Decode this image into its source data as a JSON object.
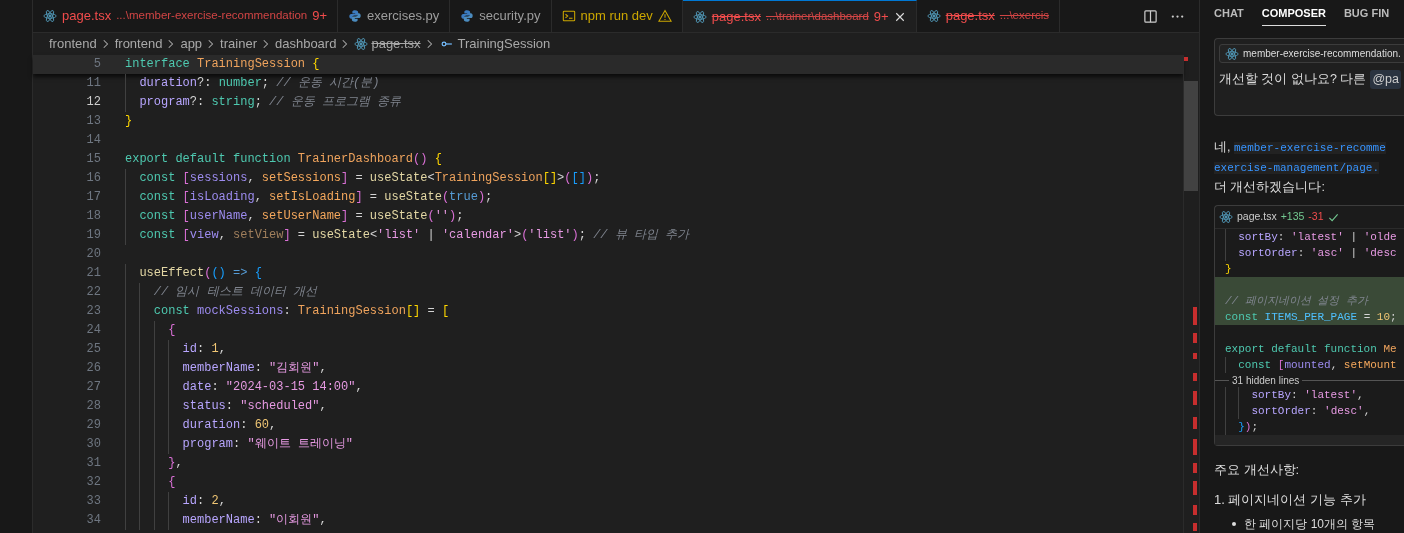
{
  "editor_tabs": [
    {
      "kind": "react",
      "label": "page.tsx",
      "path": "...\\member-exercise-recommendation",
      "badge": "9+",
      "error": true,
      "warning": false,
      "struck": false,
      "selected": false
    },
    {
      "kind": "python",
      "label": "exercises.py",
      "error": false,
      "warning": false,
      "struck": false,
      "selected": false
    },
    {
      "kind": "python",
      "label": "security.py",
      "error": false,
      "warning": false,
      "struck": false,
      "selected": false
    },
    {
      "kind": "terminal",
      "label": "npm run dev",
      "error": false,
      "warning": true,
      "struck": false,
      "selected": false
    },
    {
      "kind": "react",
      "label": "page.tsx",
      "path": "...\\trainer\\dashboard",
      "badge": "9+",
      "error": true,
      "warning": false,
      "struck": true,
      "selected": true
    },
    {
      "kind": "react",
      "label": "page.tsx",
      "path": "...\\exercis",
      "error": true,
      "warning": false,
      "struck": true,
      "selected": false
    }
  ],
  "breadcrumb": [
    {
      "kind": "folder",
      "text": "frontend",
      "struck": false
    },
    {
      "kind": "folder",
      "text": "frontend",
      "struck": false
    },
    {
      "kind": "folder",
      "text": "app",
      "struck": false
    },
    {
      "kind": "folder",
      "text": "trainer",
      "struck": false
    },
    {
      "kind": "folder",
      "text": "dashboard",
      "struck": false
    },
    {
      "kind": "file",
      "text": "page.tsx",
      "struck": true
    },
    {
      "kind": "symbol",
      "text": "TrainingSession",
      "struck": false
    }
  ],
  "code": {
    "lines": [
      {
        "number": "5",
        "sticky": true,
        "active": false,
        "tokens": [
          {
            "text": "interface ",
            "kind": "kw"
          },
          {
            "text": "TrainingSession ",
            "kind": "type"
          },
          {
            "text": "{",
            "kind": "b1"
          }
        ]
      },
      {
        "number": "11",
        "sticky": false,
        "active": false,
        "tokens": [
          {
            "text": "  duration",
            "kind": "prop"
          },
          {
            "text": "?: ",
            "kind": "p"
          },
          {
            "text": "number",
            "kind": "kw"
          },
          {
            "text": "; ",
            "kind": "p"
          },
          {
            "text": "// 운동 시간(분)",
            "kind": "comment"
          }
        ]
      },
      {
        "number": "12",
        "sticky": false,
        "active": true,
        "tokens": [
          {
            "text": "  program",
            "kind": "prop"
          },
          {
            "text": "?: ",
            "kind": "p"
          },
          {
            "text": "string",
            "kind": "kw"
          },
          {
            "text": "; ",
            "kind": "p"
          },
          {
            "text": "// 운동 프로그램 종류",
            "kind": "comment"
          }
        ]
      },
      {
        "number": "13",
        "sticky": false,
        "active": false,
        "tokens": [
          {
            "text": "}",
            "kind": "b1"
          }
        ]
      },
      {
        "number": "14",
        "sticky": false,
        "active": false
      },
      {
        "number": "15",
        "sticky": false,
        "active": false,
        "tokens": [
          {
            "text": "export default function ",
            "kind": "kw"
          },
          {
            "text": "TrainerDashboard",
            "kind": "type"
          },
          {
            "text": "() ",
            "kind": "b2"
          },
          {
            "text": "{",
            "kind": "b1"
          }
        ]
      },
      {
        "number": "16",
        "sticky": false,
        "active": false,
        "tokens": [
          {
            "text": "  const ",
            "kind": "kw"
          },
          {
            "text": "[",
            "kind": "b2"
          },
          {
            "text": "sessions",
            "kind": "var"
          },
          {
            "text": ", ",
            "kind": "p"
          },
          {
            "text": "setSessions",
            "kind": "fn"
          },
          {
            "text": "]",
            "kind": "b2"
          },
          {
            "text": " = ",
            "kind": "p"
          },
          {
            "text": "useState",
            "kind": "call"
          },
          {
            "text": "<",
            "kind": "p"
          },
          {
            "text": "TrainingSession",
            "kind": "type"
          },
          {
            "text": "[]",
            "kind": "b1"
          },
          {
            "text": ">",
            "kind": "p"
          },
          {
            "text": "(",
            "kind": "b2"
          },
          {
            "text": "[]",
            "kind": "b3"
          },
          {
            "text": ")",
            "kind": "b2"
          },
          {
            "text": ";",
            "kind": "p"
          }
        ]
      },
      {
        "number": "17",
        "sticky": false,
        "active": false,
        "tokens": [
          {
            "text": "  const ",
            "kind": "kw"
          },
          {
            "text": "[",
            "kind": "b2"
          },
          {
            "text": "isLoading",
            "kind": "var"
          },
          {
            "text": ", ",
            "kind": "p"
          },
          {
            "text": "setIsLoading",
            "kind": "fn"
          },
          {
            "text": "]",
            "kind": "b2"
          },
          {
            "text": " = ",
            "kind": "p"
          },
          {
            "text": "useState",
            "kind": "call"
          },
          {
            "text": "(",
            "kind": "b2"
          },
          {
            "text": "true",
            "kind": "lit"
          },
          {
            "text": ")",
            "kind": "b2"
          },
          {
            "text": ";",
            "kind": "p"
          }
        ]
      },
      {
        "number": "18",
        "sticky": false,
        "active": false,
        "tokens": [
          {
            "text": "  const ",
            "kind": "kw"
          },
          {
            "text": "[",
            "kind": "b2"
          },
          {
            "text": "userName",
            "kind": "var"
          },
          {
            "text": ", ",
            "kind": "p"
          },
          {
            "text": "setUserName",
            "kind": "fn"
          },
          {
            "text": "]",
            "kind": "b2"
          },
          {
            "text": " = ",
            "kind": "p"
          },
          {
            "text": "useState",
            "kind": "call"
          },
          {
            "text": "(",
            "kind": "b2"
          },
          {
            "text": "''",
            "kind": "str"
          },
          {
            "text": ")",
            "kind": "b2"
          },
          {
            "text": ";",
            "kind": "p"
          }
        ]
      },
      {
        "number": "19",
        "sticky": false,
        "active": false,
        "tokens": [
          {
            "text": "  const ",
            "kind": "kw"
          },
          {
            "text": "[",
            "kind": "b2"
          },
          {
            "text": "view",
            "kind": "var"
          },
          {
            "text": ", ",
            "kind": "p"
          },
          {
            "text": "setView",
            "kind": "unused"
          },
          {
            "text": "]",
            "kind": "b2"
          },
          {
            "text": " = ",
            "kind": "p"
          },
          {
            "text": "useState",
            "kind": "call"
          },
          {
            "text": "<",
            "kind": "p"
          },
          {
            "text": "'list'",
            "kind": "str"
          },
          {
            "text": " | ",
            "kind": "p"
          },
          {
            "text": "'calendar'",
            "kind": "str"
          },
          {
            "text": ">",
            "kind": "p"
          },
          {
            "text": "(",
            "kind": "b2"
          },
          {
            "text": "'list'",
            "kind": "str"
          },
          {
            "text": ")",
            "kind": "b2"
          },
          {
            "text": "; ",
            "kind": "p"
          },
          {
            "text": "// 뷰 타입 추가",
            "kind": "comment"
          }
        ]
      },
      {
        "number": "20",
        "sticky": false,
        "active": false
      },
      {
        "number": "21",
        "sticky": false,
        "active": false,
        "tokens": [
          {
            "text": "  useEffect",
            "kind": "call"
          },
          {
            "text": "(",
            "kind": "b2"
          },
          {
            "text": "()",
            "kind": "b3"
          },
          {
            "text": " => ",
            "kind": "lit"
          },
          {
            "text": "{",
            "kind": "b3"
          }
        ]
      },
      {
        "number": "22",
        "sticky": false,
        "active": false,
        "tokens": [
          {
            "text": "    // 임시 테스트 데이터 개선",
            "kind": "comment"
          }
        ]
      },
      {
        "number": "23",
        "sticky": false,
        "active": false,
        "tokens": [
          {
            "text": "    const ",
            "kind": "kw"
          },
          {
            "text": "mockSessions",
            "kind": "var"
          },
          {
            "text": ": ",
            "kind": "p"
          },
          {
            "text": "TrainingSession",
            "kind": "type"
          },
          {
            "text": "[]",
            "kind": "b1"
          },
          {
            "text": " = ",
            "kind": "p"
          },
          {
            "text": "[",
            "kind": "b1"
          }
        ]
      },
      {
        "number": "24",
        "sticky": false,
        "active": false,
        "tokens": [
          {
            "text": "      {",
            "kind": "b2"
          }
        ]
      },
      {
        "number": "25",
        "sticky": false,
        "active": false,
        "tokens": [
          {
            "text": "        id",
            "kind": "prop"
          },
          {
            "text": ": ",
            "kind": "p"
          },
          {
            "text": "1",
            "kind": "num"
          },
          {
            "text": ",",
            "kind": "p"
          }
        ]
      },
      {
        "number": "26",
        "sticky": false,
        "active": false,
        "tokens": [
          {
            "text": "        memberName",
            "kind": "prop"
          },
          {
            "text": ": ",
            "kind": "p"
          },
          {
            "text": "\"김회원\"",
            "kind": "str"
          },
          {
            "text": ",",
            "kind": "p"
          }
        ]
      },
      {
        "number": "27",
        "sticky": false,
        "active": false,
        "tokens": [
          {
            "text": "        date",
            "kind": "prop"
          },
          {
            "text": ": ",
            "kind": "p"
          },
          {
            "text": "\"2024-03-15 14:00\"",
            "kind": "str"
          },
          {
            "text": ",",
            "kind": "p"
          }
        ]
      },
      {
        "number": "28",
        "sticky": false,
        "active": false,
        "tokens": [
          {
            "text": "        status",
            "kind": "prop"
          },
          {
            "text": ": ",
            "kind": "p"
          },
          {
            "text": "\"scheduled\"",
            "kind": "str"
          },
          {
            "text": ",",
            "kind": "p"
          }
        ]
      },
      {
        "number": "29",
        "sticky": false,
        "active": false,
        "tokens": [
          {
            "text": "        duration",
            "kind": "prop"
          },
          {
            "text": ": ",
            "kind": "p"
          },
          {
            "text": "60",
            "kind": "num"
          },
          {
            "text": ",",
            "kind": "p"
          }
        ]
      },
      {
        "number": "30",
        "sticky": false,
        "active": false,
        "tokens": [
          {
            "text": "        program",
            "kind": "prop"
          },
          {
            "text": ": ",
            "kind": "p"
          },
          {
            "text": "\"웨이트 트레이닝\"",
            "kind": "str"
          }
        ]
      },
      {
        "number": "31",
        "sticky": false,
        "active": false,
        "tokens": [
          {
            "text": "      }",
            "kind": "b2"
          },
          {
            "text": ",",
            "kind": "p"
          }
        ]
      },
      {
        "number": "32",
        "sticky": false,
        "active": false,
        "tokens": [
          {
            "text": "      {",
            "kind": "b2"
          }
        ]
      },
      {
        "number": "33",
        "sticky": false,
        "active": false,
        "tokens": [
          {
            "text": "        id",
            "kind": "prop"
          },
          {
            "text": ": ",
            "kind": "p"
          },
          {
            "text": "2",
            "kind": "num"
          },
          {
            "text": ",",
            "kind": "p"
          }
        ]
      },
      {
        "number": "34",
        "sticky": false,
        "active": false,
        "tokens": [
          {
            "text": "        memberName",
            "kind": "prop"
          },
          {
            "text": ": ",
            "kind": "p"
          },
          {
            "text": "\"이회원\"",
            "kind": "str"
          },
          {
            "text": ",",
            "kind": "p"
          }
        ]
      }
    ]
  },
  "panel": {
    "tabs": [
      {
        "label": "CHAT",
        "selected": false
      },
      {
        "label": "COMPOSER",
        "selected": true
      },
      {
        "label": "BUG FIN",
        "selected": false
      }
    ],
    "prompt": {
      "chip": "member-exercise-recommendation.",
      "text": "개선할 것이 없나요? 다른",
      "mention": "@pa"
    },
    "reply": {
      "lead": "네,",
      "code_1": "member-exercise-recomme",
      "code_2": "exercise-management/page.",
      "tail": "더 개선하겠습니다:"
    },
    "diff": {
      "file": "page.tsx",
      "added": "+135",
      "removed": "-31",
      "lines_before": [
        {
          "added": false,
          "tokens": [
            {
              "text": "  sortBy",
              "kind": "prop"
            },
            {
              "text": ": ",
              "kind": "p"
            },
            {
              "text": "'latest'",
              "kind": "str"
            },
            {
              "text": " | ",
              "kind": "p"
            },
            {
              "text": "'olde",
              "kind": "str"
            }
          ]
        },
        {
          "added": false,
          "tokens": [
            {
              "text": "  sortOrder",
              "kind": "prop"
            },
            {
              "text": ": ",
              "kind": "p"
            },
            {
              "text": "'asc'",
              "kind": "str"
            },
            {
              "text": " | ",
              "kind": "p"
            },
            {
              "text": "'desc",
              "kind": "str"
            }
          ]
        },
        {
          "added": false,
          "tokens": [
            {
              "text": "}",
              "kind": "b1"
            }
          ]
        },
        {
          "added": true
        },
        {
          "added": true,
          "tokens": [
            {
              "text": "// 페이지네이션 설정 추가",
              "kind": "comment"
            }
          ]
        },
        {
          "added": true,
          "tokens": [
            {
              "text": "const ",
              "kind": "kw"
            },
            {
              "text": "ITEMS_PER_PAGE",
              "kind": "const"
            },
            {
              "text": " = ",
              "kind": "p"
            },
            {
              "text": "10",
              "kind": "num"
            },
            {
              "text": ";",
              "kind": "p"
            }
          ]
        },
        {
          "added": false,
          "space_above": true,
          "tokens": [
            {
              "text": "export default function ",
              "kind": "kw"
            },
            {
              "text": "Me",
              "kind": "type"
            }
          ]
        },
        {
          "added": false,
          "tokens": [
            {
              "text": "  const ",
              "kind": "kw"
            },
            {
              "text": "[",
              "kind": "b2"
            },
            {
              "text": "mounted",
              "kind": "var"
            },
            {
              "text": ", ",
              "kind": "p"
            },
            {
              "text": "setMount",
              "kind": "fn"
            }
          ]
        }
      ],
      "hidden": "31 hidden lines",
      "lines_after": [
        {
          "added": false,
          "tokens": [
            {
              "text": "    sortBy",
              "kind": "prop"
            },
            {
              "text": ": ",
              "kind": "p"
            },
            {
              "text": "'latest'",
              "kind": "str"
            },
            {
              "text": ",",
              "kind": "p"
            }
          ]
        },
        {
          "added": false,
          "tokens": [
            {
              "text": "    sortOrder",
              "kind": "prop"
            },
            {
              "text": ": ",
              "kind": "p"
            },
            {
              "text": "'desc'",
              "kind": "str"
            },
            {
              "text": ",",
              "kind": "p"
            }
          ]
        },
        {
          "added": false,
          "tokens": [
            {
              "text": "  }",
              "kind": "b3"
            },
            {
              "text": ")",
              "kind": "b2"
            },
            {
              "text": ";",
              "kind": "p"
            }
          ]
        }
      ]
    },
    "heading": "주요 개선사항:",
    "items": [
      {
        "text": "1. 페이지네이션 기능 추가",
        "children": [
          {
            "text": "한 페이지당 10개의 항목"
          }
        ]
      }
    ]
  }
}
